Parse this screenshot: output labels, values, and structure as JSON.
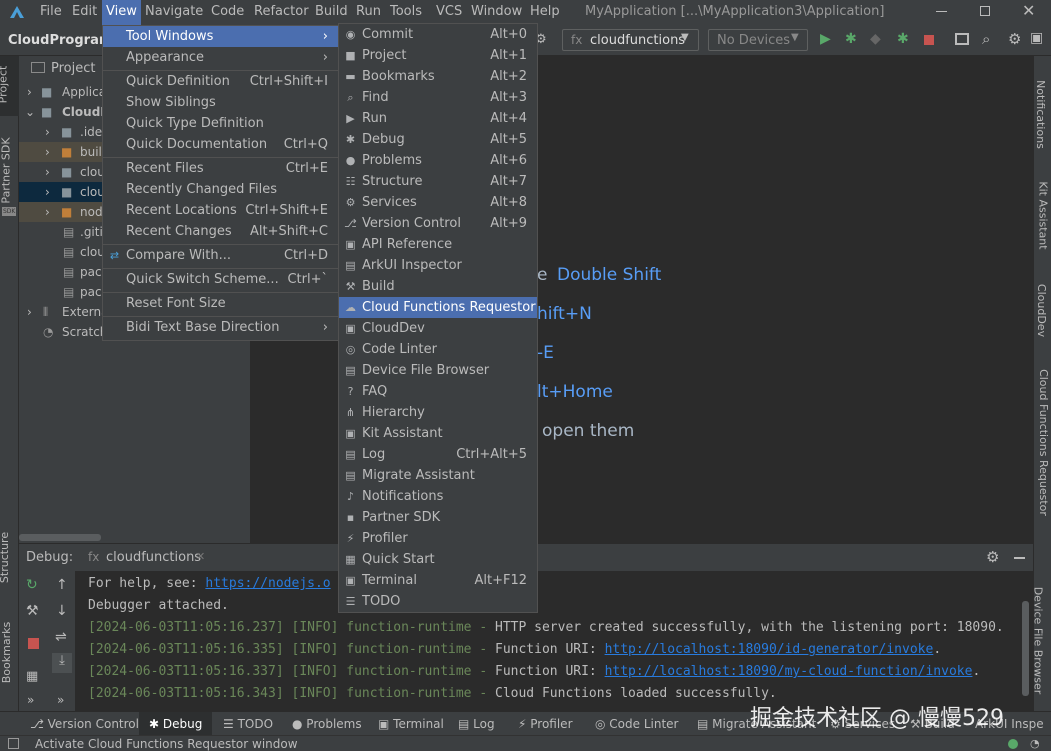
{
  "menubar": {
    "items": [
      "File",
      "Edit",
      "View",
      "Navigate",
      "Code",
      "Refactor",
      "Build",
      "Run",
      "Tools",
      "VCS",
      "Window",
      "Help"
    ],
    "window_title": "MyApplication [...\\MyApplication3\\Application]"
  },
  "navbar": {
    "project": "CloudProgram",
    "run_config": "cloudfunctions",
    "device": "No Devices"
  },
  "left_strip": {
    "project": "Project",
    "partner_sdk": "Partner SDK",
    "structure": "Structure",
    "bookmarks": "Bookmarks"
  },
  "right_strip": {
    "notifications": "Notifications",
    "kit_assistant": "Kit Assistant",
    "clouddev": "CloudDev",
    "cfr": "Cloud Functions Requestor",
    "dfb": "Device File Browser"
  },
  "project_panel": {
    "title": "Project",
    "items": [
      "Applica",
      "CloudP",
      ".ide",
      "buil",
      "clou",
      "clou",
      "nod",
      ".giti",
      "clou",
      "pac",
      "pac",
      "Externa",
      "Scratch"
    ]
  },
  "editor_hints": {
    "h1": "e",
    "h1b": "Double Shift",
    "h2": "hift+N",
    "h3": "-E",
    "h4": "lt+Home",
    "h5": "open them"
  },
  "view_menu": {
    "items": [
      {
        "label": "Tool Windows",
        "shortcut": ""
      },
      {
        "label": "Appearance",
        "shortcut": ""
      },
      {
        "label": "Quick Definition",
        "shortcut": "Ctrl+Shift+I"
      },
      {
        "label": "Show Siblings",
        "shortcut": ""
      },
      {
        "label": "Quick Type Definition",
        "shortcut": ""
      },
      {
        "label": "Quick Documentation",
        "shortcut": "Ctrl+Q"
      },
      {
        "label": "Recent Files",
        "shortcut": "Ctrl+E"
      },
      {
        "label": "Recently Changed Files",
        "shortcut": ""
      },
      {
        "label": "Recent Locations",
        "shortcut": "Ctrl+Shift+E"
      },
      {
        "label": "Recent Changes",
        "shortcut": "Alt+Shift+C"
      },
      {
        "label": "Compare With...",
        "shortcut": "Ctrl+D"
      },
      {
        "label": "Quick Switch Scheme...",
        "shortcut": "Ctrl+`"
      },
      {
        "label": "Reset Font Size",
        "shortcut": ""
      },
      {
        "label": "Bidi Text Base Direction",
        "shortcut": ""
      }
    ]
  },
  "tool_windows_menu": {
    "items": [
      {
        "label": "Commit",
        "shortcut": "Alt+0",
        "icon": "commit-icon"
      },
      {
        "label": "Project",
        "shortcut": "Alt+1",
        "icon": "folder-icon"
      },
      {
        "label": "Bookmarks",
        "shortcut": "Alt+2",
        "icon": "bookmark-icon"
      },
      {
        "label": "Find",
        "shortcut": "Alt+3",
        "icon": "search-icon"
      },
      {
        "label": "Run",
        "shortcut": "Alt+4",
        "icon": "run-icon"
      },
      {
        "label": "Debug",
        "shortcut": "Alt+5",
        "icon": "bug-icon"
      },
      {
        "label": "Problems",
        "shortcut": "Alt+6",
        "icon": "problems-icon"
      },
      {
        "label": "Structure",
        "shortcut": "Alt+7",
        "icon": "structure-icon"
      },
      {
        "label": "Services",
        "shortcut": "Alt+8",
        "icon": "services-icon"
      },
      {
        "label": "Version Control",
        "shortcut": "Alt+9",
        "icon": "vcs-icon"
      },
      {
        "label": "API Reference",
        "shortcut": "",
        "icon": "api-icon"
      },
      {
        "label": "ArkUI Inspector",
        "shortcut": "",
        "icon": "inspector-icon"
      },
      {
        "label": "Build",
        "shortcut": "",
        "icon": "build-icon"
      },
      {
        "label": "Cloud Functions Requestor",
        "shortcut": "",
        "icon": "cloud-icon"
      },
      {
        "label": "CloudDev",
        "shortcut": "",
        "icon": "clouddev-icon"
      },
      {
        "label": "Code Linter",
        "shortcut": "",
        "icon": "linter-icon"
      },
      {
        "label": "Device File Browser",
        "shortcut": "",
        "icon": "device-icon"
      },
      {
        "label": "FAQ",
        "shortcut": "",
        "icon": "faq-icon"
      },
      {
        "label": "Hierarchy",
        "shortcut": "",
        "icon": "hierarchy-icon"
      },
      {
        "label": "Kit Assistant",
        "shortcut": "",
        "icon": "kit-icon"
      },
      {
        "label": "Log",
        "shortcut": "Ctrl+Alt+5",
        "icon": "log-icon"
      },
      {
        "label": "Migrate Assistant",
        "shortcut": "",
        "icon": "migrate-icon"
      },
      {
        "label": "Notifications",
        "shortcut": "",
        "icon": "bell-icon"
      },
      {
        "label": "Partner SDK",
        "shortcut": "",
        "icon": "sdk-icon"
      },
      {
        "label": "Profiler",
        "shortcut": "",
        "icon": "profiler-icon"
      },
      {
        "label": "Quick Start",
        "shortcut": "",
        "icon": "grid-icon"
      },
      {
        "label": "Terminal",
        "shortcut": "Alt+F12",
        "icon": "terminal-icon"
      },
      {
        "label": "TODO",
        "shortcut": "",
        "icon": "todo-icon"
      }
    ]
  },
  "debug": {
    "label": "Debug:",
    "tab": "cloudfunctions"
  },
  "console": {
    "l1_text": "For help, see: ",
    "l1_link": "https://nodejs.o",
    "l2": "Debugger attached.",
    "l3_a": "[2024-06-03T11:05:16.237] [INFO] function-runtime - ",
    "l3_b": "HTTP server created successfully, with the listening port: 18090.",
    "l4_a": "[2024-06-03T11:05:16.335] [INFO] function-runtime - ",
    "l4_b": "Function URI: ",
    "l4_link": "http://localhost:18090/id-generator/invoke",
    "l4_c": ".",
    "l5_a": "[2024-06-03T11:05:16.337] [INFO] function-runtime - ",
    "l5_b": "Function URI: ",
    "l5_link": "http://localhost:18090/my-cloud-function/invoke",
    "l5_c": ".",
    "l6_a": "[2024-06-03T11:05:16.343] [INFO] function-runtime - ",
    "l6_b": "Cloud Functions loaded successfully."
  },
  "toolwindow_bar": [
    "Version Control",
    "Debug",
    "TODO",
    "Problems",
    "Terminal",
    "Log",
    "Profiler",
    "Code Linter",
    "Migrate Assistant",
    "Services",
    "Build",
    "ArkUI Inspe"
  ],
  "status": "Activate Cloud Functions Requestor window",
  "watermark": "掘金技术社区 @ 慢慢529"
}
